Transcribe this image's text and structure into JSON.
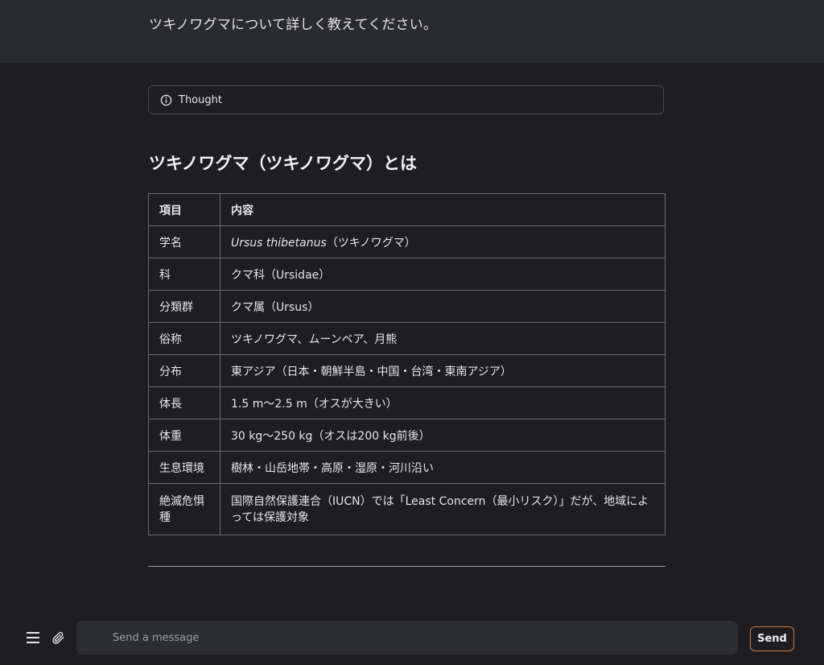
{
  "user_message": "ツキノワグマについて詳しく教えてください。",
  "thought": {
    "label": "Thought",
    "icon": "info-circle-icon"
  },
  "answer": {
    "heading": "ツキノワグマ（ツキノワグマ）とは",
    "table": {
      "headers": [
        "項目",
        "内容"
      ],
      "rows": [
        {
          "key": "学名",
          "value_italic": "Ursus thibetanus",
          "value": "（ツキノワグマ）"
        },
        {
          "key": "科",
          "value_italic": "",
          "value": "クマ科（Ursidae）"
        },
        {
          "key": "分類群",
          "value_italic": "",
          "value": "クマ属（Ursus）"
        },
        {
          "key": "俗称",
          "value_italic": "",
          "value": "ツキノワグマ、ムーンベア、月熊"
        },
        {
          "key": "分布",
          "value_italic": "",
          "value": "東アジア（日本・朝鮮半島・中国・台湾・東南アジア）"
        },
        {
          "key": "体長",
          "value_italic": "",
          "value": "1.5 m〜2.5 m（オスが大きい）"
        },
        {
          "key": "体重",
          "value_italic": "",
          "value": "30 kg〜250 kg（オスは200 kg前後）"
        },
        {
          "key": "生息環境",
          "value_italic": "",
          "value": "樹林・山岳地帯・高原・湿原・河川沿い"
        },
        {
          "key": "絶滅危惧種",
          "value_italic": "",
          "value": "国際自然保護連合（IUCN）では「Least Concern（最小リスク）」だが、地域によっては保護対象"
        }
      ]
    }
  },
  "composer": {
    "placeholder": "Send a message",
    "value": "",
    "send_label": "Send",
    "menu_icon": "hamburger-menu-icon",
    "attach_icon": "paperclip-icon"
  },
  "colors": {
    "background": "#1e1d21",
    "user_band": "#2a2b2f",
    "input_bg": "#2d2e33",
    "send_border": "#d4763a"
  }
}
